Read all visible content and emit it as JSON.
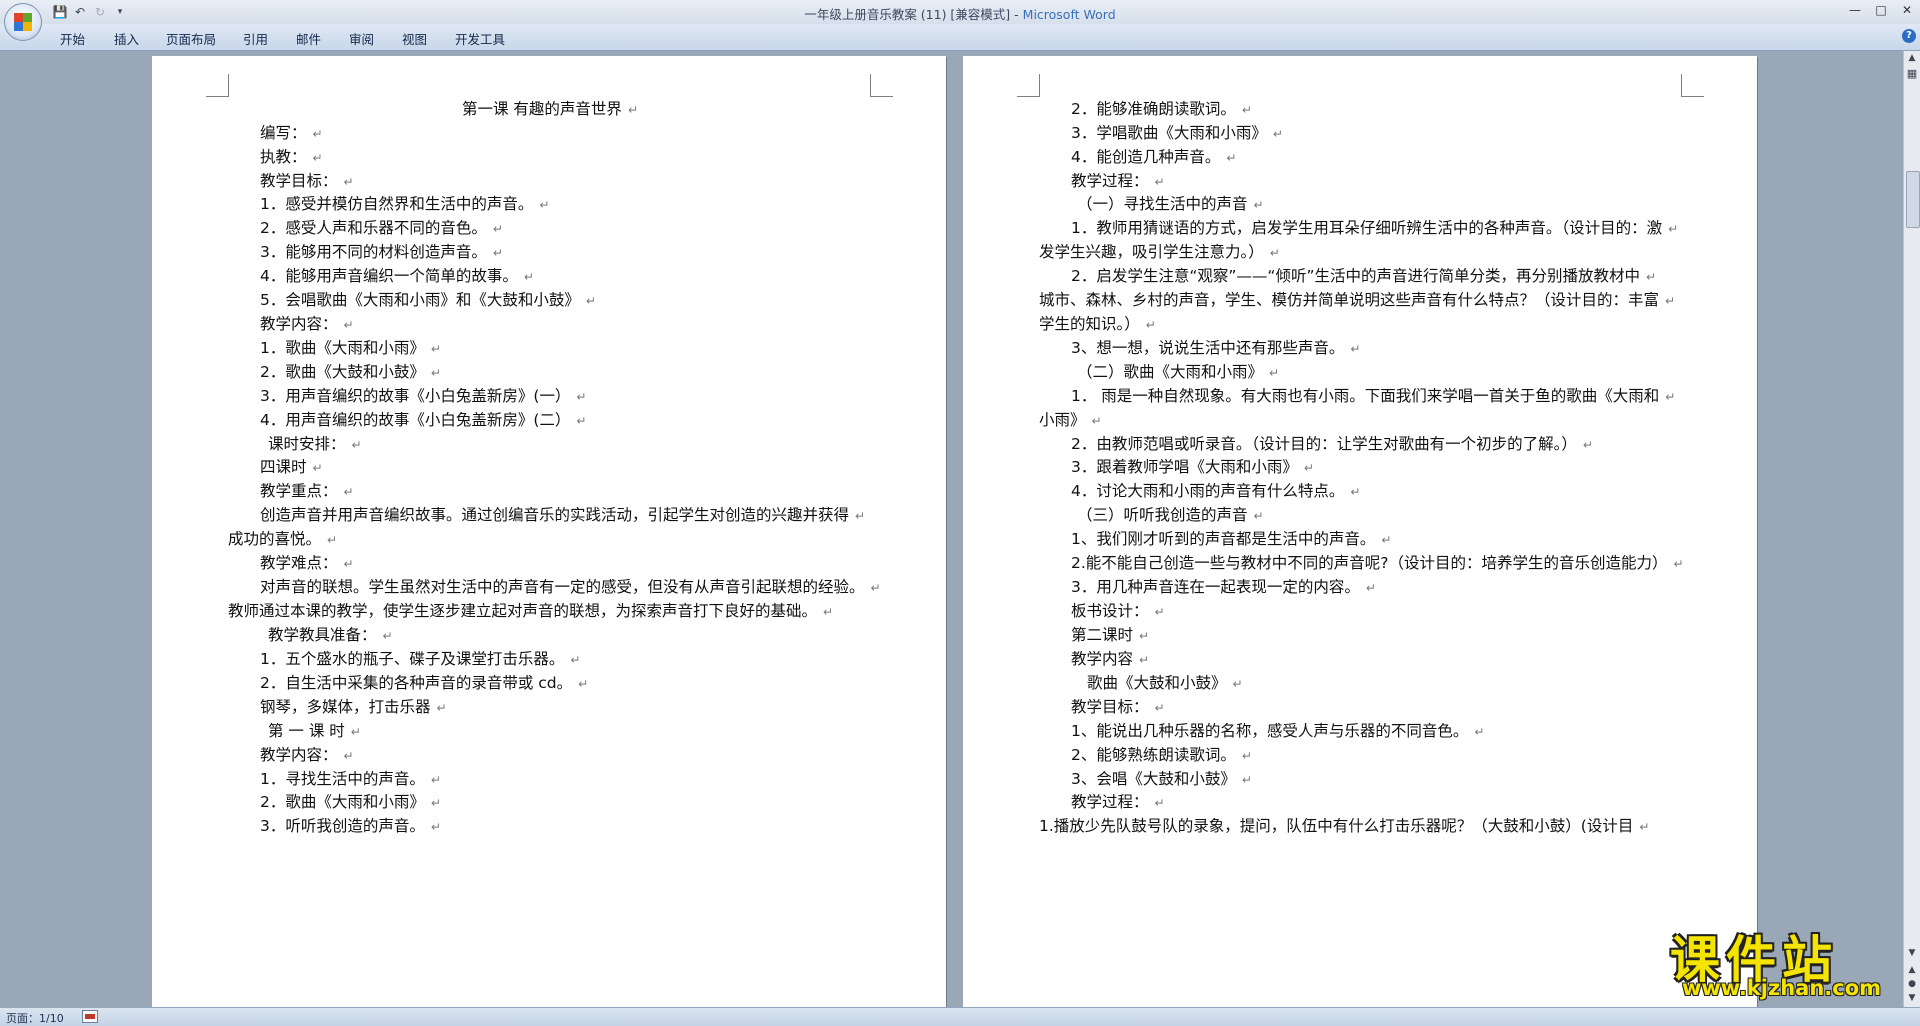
{
  "window": {
    "title_doc": "一年级上册音乐教案 (11) [兼容模式] - ",
    "title_app": "Microsoft Word"
  },
  "colors": {
    "accent": "#3a6fb8",
    "watermark": "#f4e400"
  },
  "ribbon": {
    "tabs": [
      "开始",
      "插入",
      "页面布局",
      "引用",
      "邮件",
      "审阅",
      "视图",
      "开发工具"
    ]
  },
  "pages": [
    {
      "lines": [
        "第一课          有趣的声音世界",
        "编写：",
        "执教：",
        "教学目标：",
        "1．感受并模仿自然界和生活中的声音。",
        "2．感受人声和乐器不同的音色。",
        "3．能够用不同的材料创造声音。",
        "4．能够用声音编织一个简单的故事。",
        "5．会唱歌曲《大雨和小雨》和《大鼓和小鼓》",
        "教学内容：",
        "1．歌曲《大雨和小雨》",
        "2．歌曲《大鼓和小鼓》",
        "3．用声音编织的故事《小白兔盖新房》(一）",
        "4．用声音编织的故事《小白兔盖新房》(二）",
        "课时安排：",
        "四课时",
        "教学重点：",
        "创造声音并用声音编织故事。通过创编音乐的实践活动，引起学生对创造的兴趣并获得",
        "成功的喜悦。",
        "教学难点：",
        "对声音的联想。学生虽然对生活中的声音有一定的感受，但没有从声音引起联想的经验。",
        "教师通过本课的教学，使学生逐步建立起对声音的联想，为探索声音打下良好的基础。",
        "教学教具准备：",
        "1．五个盛水的瓶子、碟子及课堂打击乐器。",
        "2．自生活中采集的各种声音的录音带或 cd。",
        "钢琴，多媒体，打击乐器",
        "第 一 课 时",
        "教学内容：",
        "1．寻找生活中的声音。",
        "2．歌曲《大雨和小雨》",
        "3．听听我创造的声音。"
      ]
    },
    {
      "lines": [
        "2．能够准确朗读歌词。",
        "3．学唱歌曲《大雨和小雨》",
        "4．能创造几种声音。",
        "教学过程：",
        "（一）寻找生活中的声音",
        "1．教师用猜谜语的方式，启发学生用耳朵仔细听辨生活中的各种声音。（设计目的：激",
        "发学生兴趣，吸引学生注意力。）",
        "2．启发学生注意“观察”——“倾听”生活中的声音进行简单分类，再分别播放教材中",
        "城市、森林、乡村的声音，学生、模仿并简单说明这些声音有什么特点？（设计目的：丰富",
        "学生的知识。）",
        "3、想一想，说说生活中还有那些声音。",
        "（二）歌曲《大雨和小雨》",
        "1．  雨是一种自然现象。有大雨也有小雨。下面我们来学唱一首关于鱼的歌曲《大雨和",
        "小雨》",
        "2．由教师范唱或听录音。（设计目的：让学生对歌曲有一个初步的了解。）",
        "3．跟着教师学唱《大雨和小雨》",
        "4．讨论大雨和小雨的声音有什么特点。",
        "（三）听听我创造的声音",
        "1、我们刚才听到的声音都是生活中的声音。",
        "2.能不能自己创造一些与教材中不同的声音呢?（设计目的：培养学生的音乐创造能力）",
        "3．用几种声音连在一起表现一定的内容。",
        "板书设计：",
        "第二课时",
        "教学内容",
        "歌曲《大鼓和小鼓》",
        "教学目标：",
        "1、能说出几种乐器的名称，感受人声与乐器的不同音色。",
        "2、能够熟练朗读歌词。",
        "3、会唱《大鼓和小鼓》",
        "教学过程：",
        "1.播放少先队鼓号队的录象，提问，队伍中有什么打击乐器呢？（大鼓和小鼓）(设计目"
      ]
    }
  ],
  "status": {
    "page_info": "页面：1/10"
  },
  "watermark": {
    "title": "课件站",
    "url": "www.kjzhan.com"
  }
}
